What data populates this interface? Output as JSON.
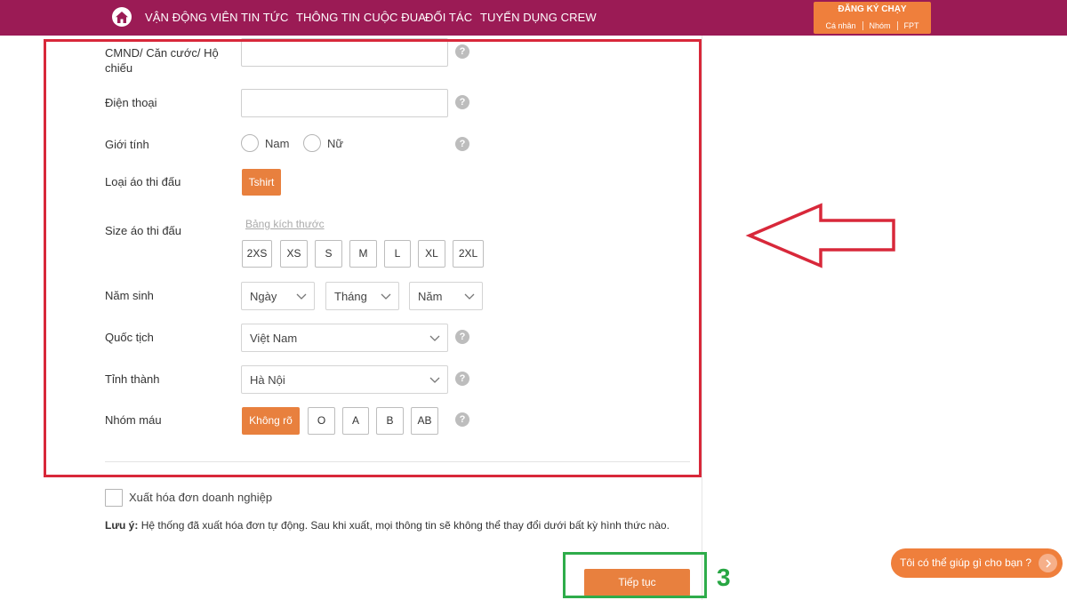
{
  "nav": {
    "items": [
      "VẬN ĐỘNG VIÊN",
      "TIN TỨC",
      "THÔNG TIN CUỘC ĐUA",
      "ĐỐI TÁC",
      "TUYỂN DỤNG CREW"
    ],
    "register": {
      "title": "ĐĂNG KÝ CHẠY",
      "options": [
        "Cá nhân",
        "Nhóm",
        "FPT"
      ]
    }
  },
  "form": {
    "id_label": "CMND/ Căn cước/ Hộ chiếu",
    "id_value": "",
    "phone_label": "Điện thoại",
    "phone_value": "",
    "gender_label": "Giới tính",
    "gender_options": [
      "Nam",
      "Nữ"
    ],
    "shirt_type_label": "Loại áo thi đấu",
    "shirt_type_value": "Tshirt",
    "shirt_size_label": "Size áo thi đấu",
    "size_chart_link": "Bảng kích thước",
    "sizes": [
      "2XS",
      "XS",
      "S",
      "M",
      "L",
      "XL",
      "2XL"
    ],
    "birth_label": "Năm sinh",
    "birth_day": "Ngày",
    "birth_month": "Tháng",
    "birth_year": "Năm",
    "nationality_label": "Quốc tịch",
    "nationality_value": "Việt Nam",
    "province_label": "Tỉnh thành",
    "province_value": "Hà Nội",
    "blood_label": "Nhóm máu",
    "blood_selected": "Không rõ",
    "blood_options": [
      "O",
      "A",
      "B",
      "AB"
    ],
    "help_glyph": "?"
  },
  "invoice": {
    "checkbox_label": "Xuất hóa đơn doanh nghiệp",
    "note_prefix": "Lưu ý:",
    "note_text": " Hệ thống đã xuất hóa đơn tự động. Sau khi xuất, mọi thông tin sẽ không thể thay đổi dưới bất kỳ hình thức nào."
  },
  "continue_label": "Tiếp tục",
  "annotation": {
    "step_number": "3"
  },
  "chat": {
    "text": "Tôi có thể giúp gì cho bạn ?"
  },
  "colors": {
    "nav_bg": "#9b1b55",
    "accent_orange": "#e8803e",
    "annotation_red": "#d8283a",
    "annotation_green": "#2eac4a"
  }
}
